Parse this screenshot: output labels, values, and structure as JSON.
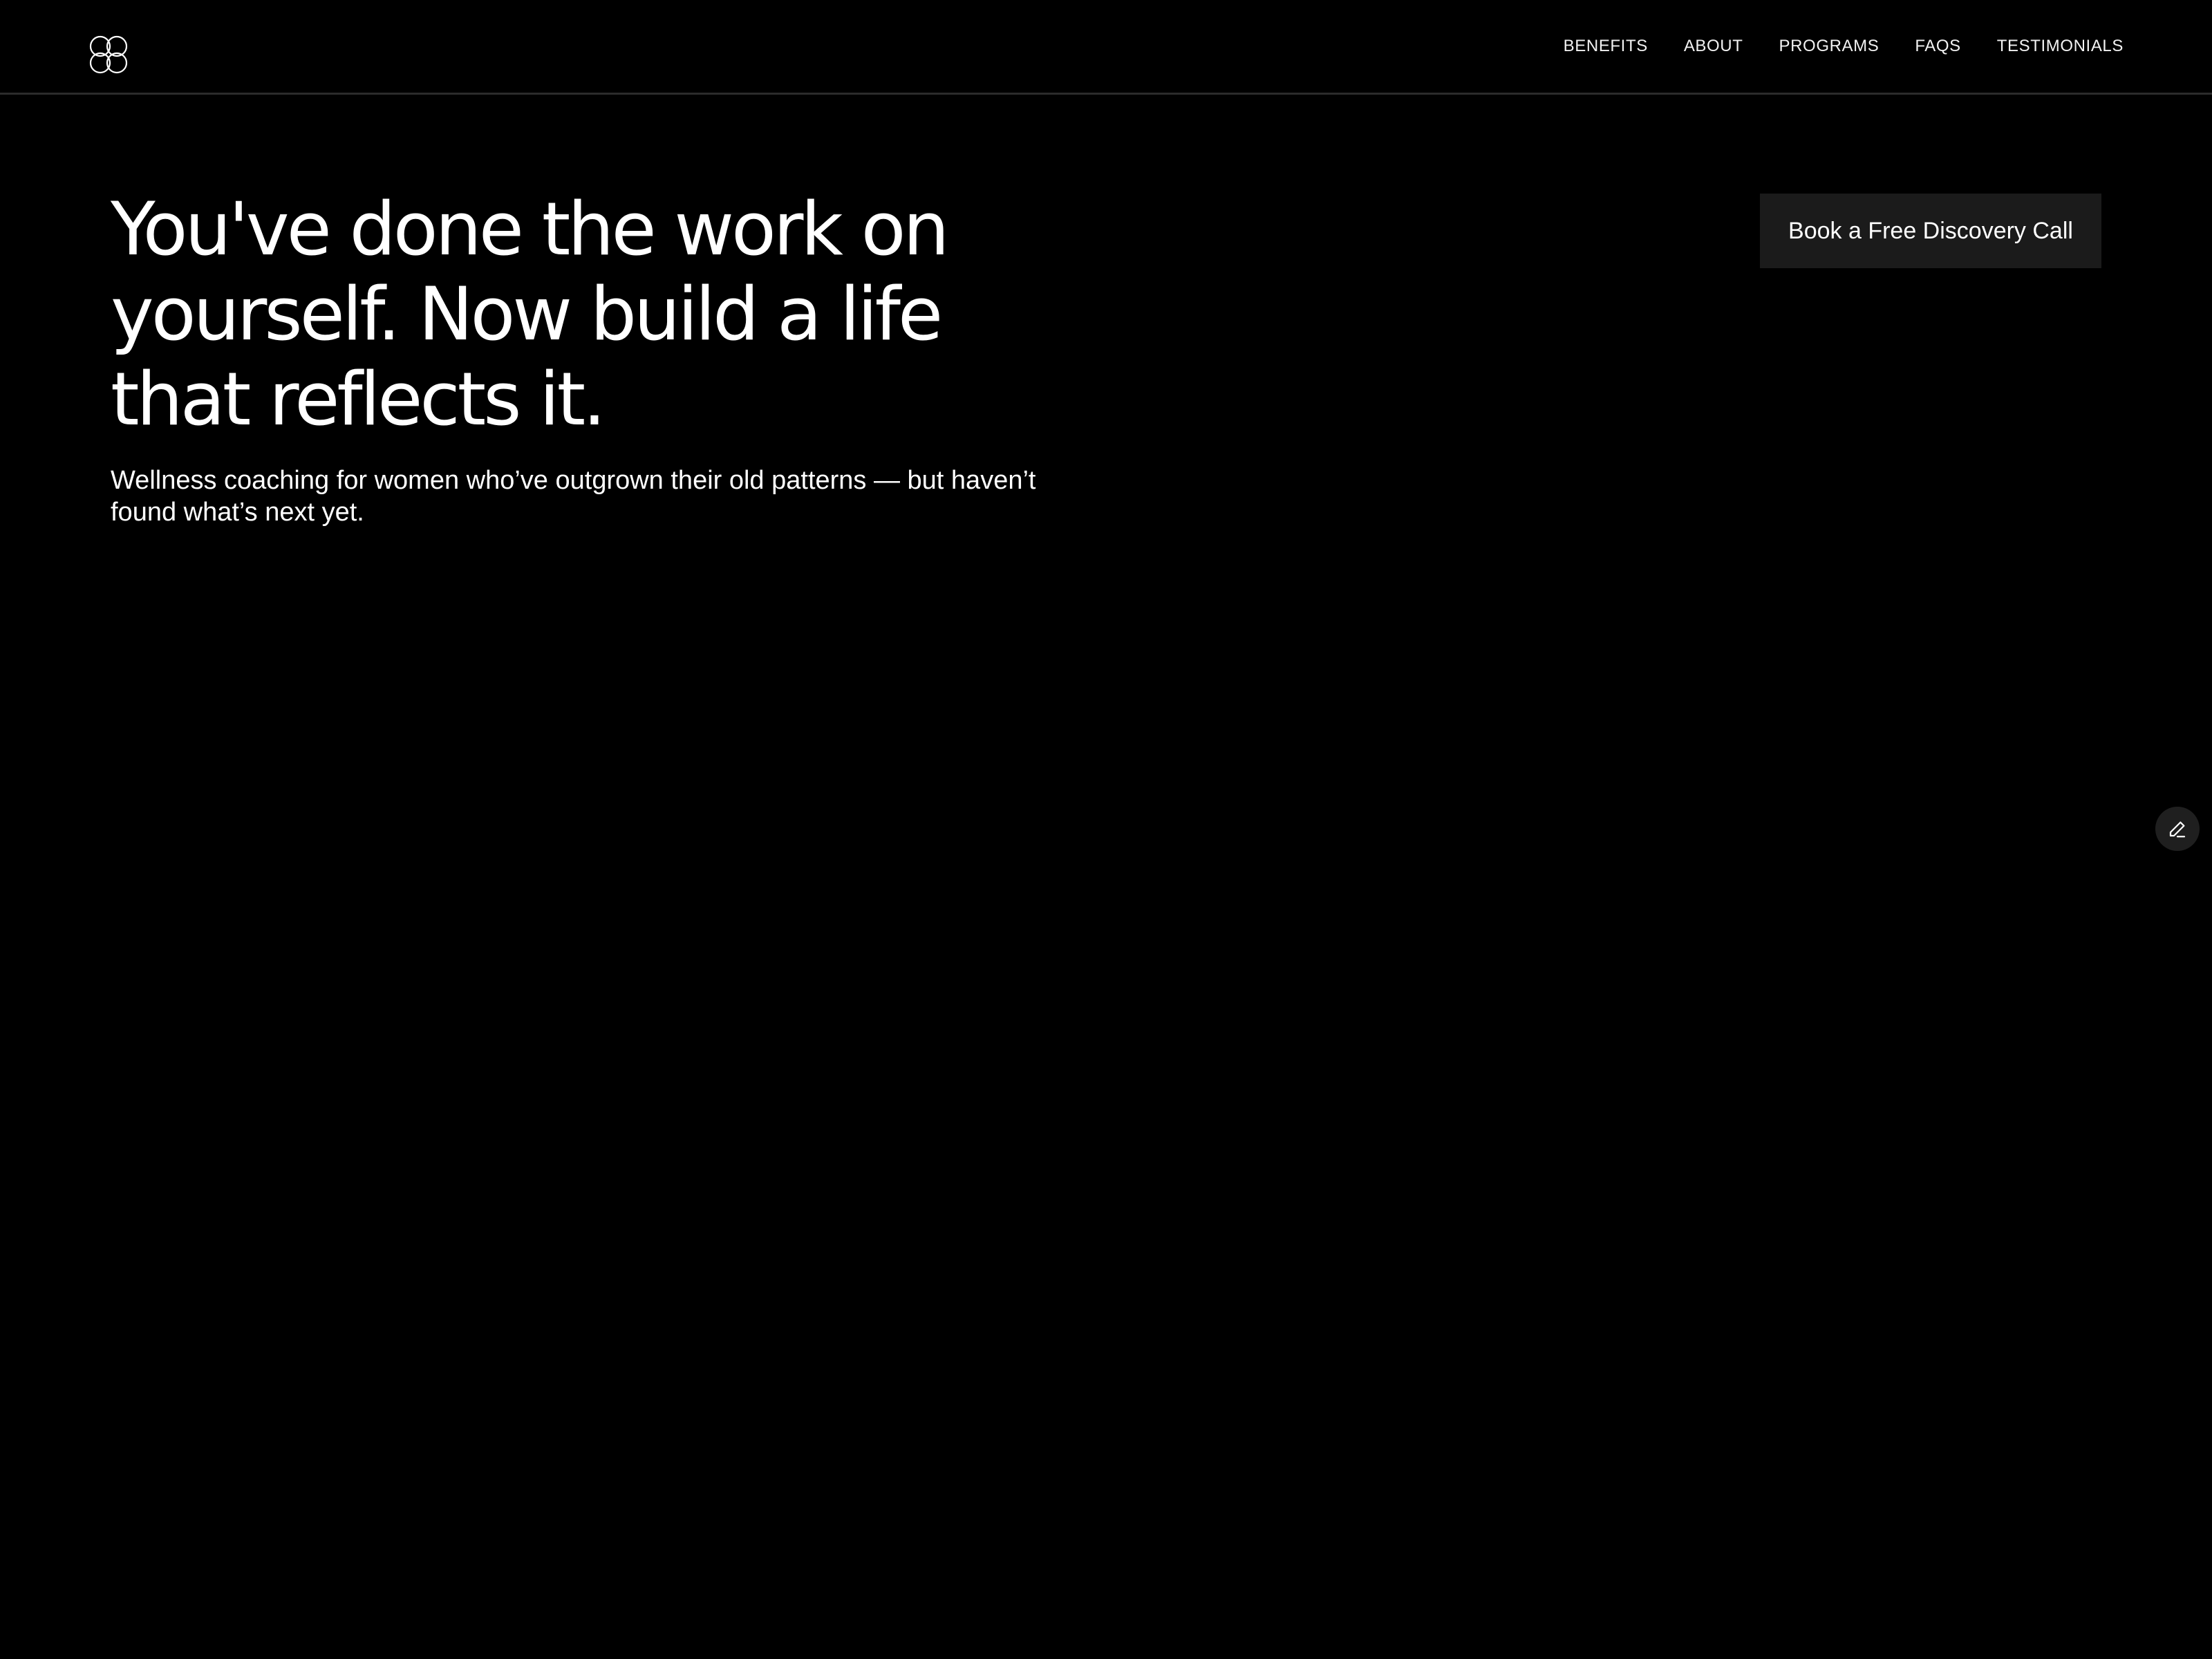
{
  "header": {
    "logo_icon": "flower-logo-icon",
    "nav": [
      {
        "label": "BENEFITS"
      },
      {
        "label": "ABOUT"
      },
      {
        "label": "PROGRAMS"
      },
      {
        "label": "FAQS"
      },
      {
        "label": "TESTIMONIALS"
      }
    ]
  },
  "hero": {
    "title": "You've done the work on yourself. Now build a life that reflects it.",
    "subtitle": "Wellness coaching for women who’ve outgrown their old patterns — but haven’t found what’s next yet.",
    "cta_label": "Book a Free Discovery Call"
  },
  "floating": {
    "edit_icon": "pencil-icon"
  },
  "colors": {
    "background": "#000000",
    "text": "#ffffff",
    "button_bg": "#1b1b1b",
    "divider": "#2b2b2b"
  }
}
